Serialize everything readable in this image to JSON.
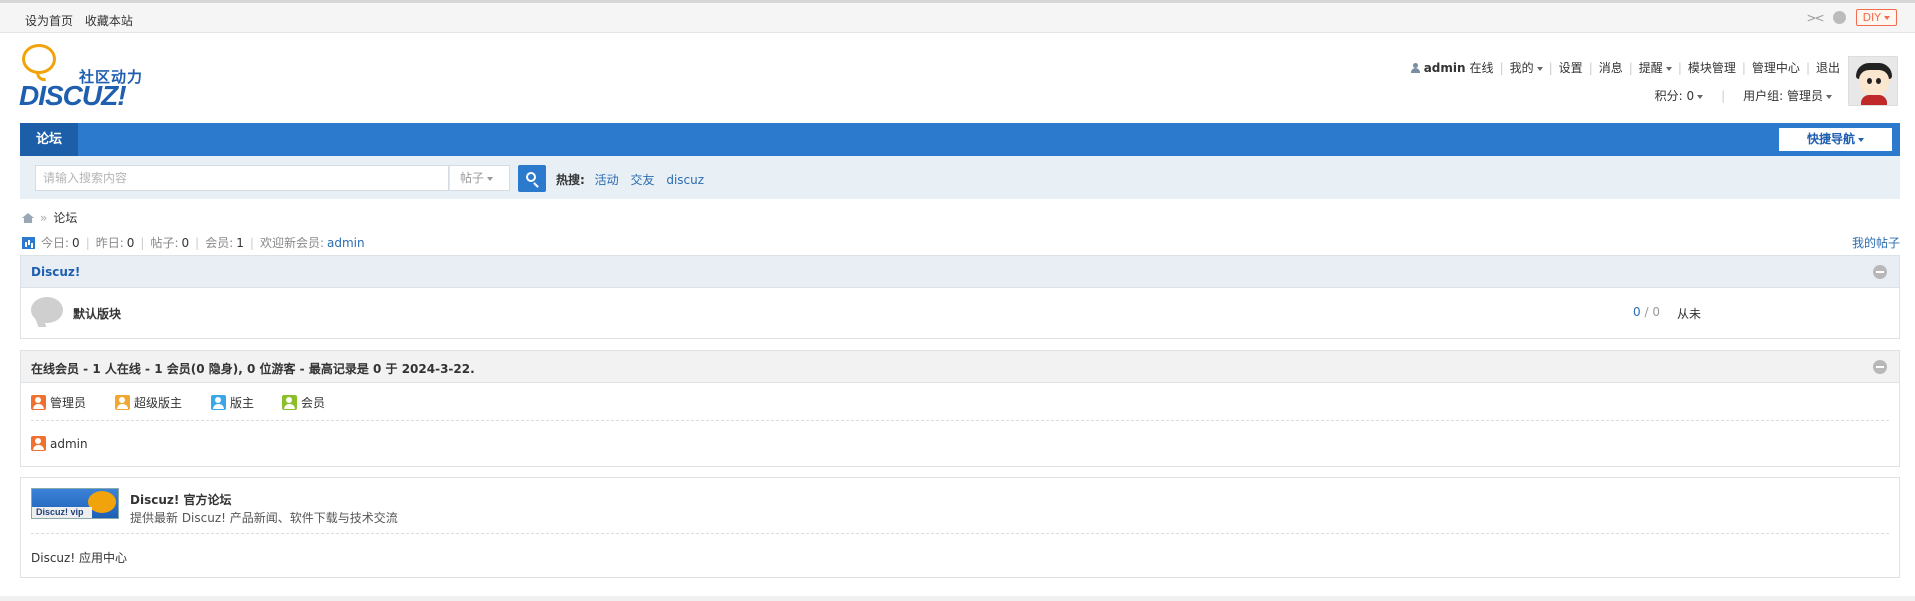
{
  "toptb": {
    "links": [
      "设为首页",
      "收藏本站"
    ],
    "collapse": "><",
    "diy": "DIY"
  },
  "header": {
    "slogan": "社区动力",
    "brand": "DISCUZ!",
    "user": {
      "name": "admin",
      "status": "在线",
      "menu": [
        "我的",
        "设置",
        "消息",
        "提醒",
        "模块管理",
        "管理中心",
        "退出"
      ],
      "points": "积分: 0",
      "group": "用户组: 管理员"
    }
  },
  "nav": {
    "tab": "论坛",
    "quick": "快捷导航"
  },
  "search": {
    "placeholder": "请输入搜索内容",
    "type": "帖子",
    "hot_label": "热搜:",
    "hot": [
      "活动",
      "交友",
      "discuz"
    ]
  },
  "breadcrumb": {
    "current": "论坛"
  },
  "stats": {
    "today_label": "今日:",
    "today": "0",
    "yesterday_label": "昨日:",
    "yesterday": "0",
    "posts_label": "帖子:",
    "posts": "0",
    "members_label": "会员:",
    "members": "1",
    "welcome_label": "欢迎新会员:",
    "newest": "admin",
    "my_posts": "我的帖子"
  },
  "category": {
    "title": "Discuz!",
    "forum": {
      "name": "默认版块",
      "threads": "0",
      "posts": "0",
      "last": "从未"
    }
  },
  "online": {
    "title": "在线会员 - 1 人在线 - 1 会员(0 隐身), 0 位游客 - 最高记录是 0 于 2024-3-22.",
    "legend": [
      {
        "label": "管理员",
        "color": "#f07030"
      },
      {
        "label": "超级版主",
        "color": "#f0a830"
      },
      {
        "label": "版主",
        "color": "#3aa8e8"
      },
      {
        "label": "会员",
        "color": "#8cc02a"
      }
    ],
    "users": [
      {
        "name": "admin",
        "color": "#f07030"
      }
    ]
  },
  "links": {
    "badge_text": "Discuz! vip",
    "title": "Discuz! 官方论坛",
    "desc": "提供最新 Discuz! 产品新闻、软件下载与技术交流",
    "app_center": "Discuz! 应用中心"
  }
}
